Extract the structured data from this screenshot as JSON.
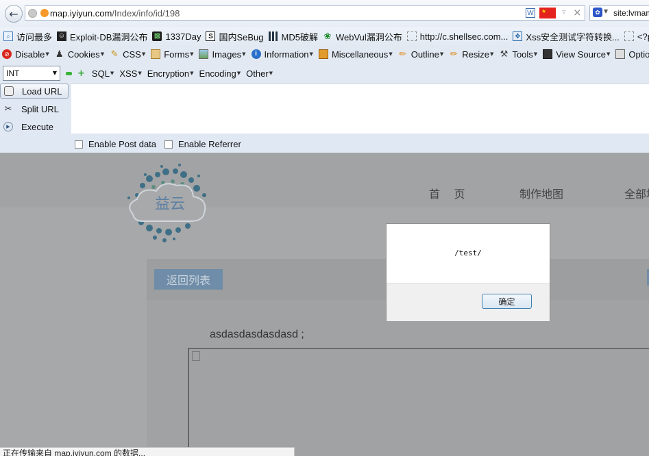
{
  "browser": {
    "url_host": "map.iyiyun.com",
    "url_path": "/Index/info/id/198",
    "search_text": "site:lvmama"
  },
  "bookmarks": [
    {
      "label": "访问最多",
      "icon": "most-visited-icon"
    },
    {
      "label": "Exploit-DB漏洞公布",
      "icon": "exploit-db-icon"
    },
    {
      "label": "1337Day",
      "icon": "1337day-icon"
    },
    {
      "label": "国内SeBug",
      "icon": "sebug-icon"
    },
    {
      "label": "MD5破解",
      "icon": "md5-icon"
    },
    {
      "label": "WebVul漏洞公布",
      "icon": "webvul-icon"
    },
    {
      "label": "http://c.shellsec.com...",
      "icon": "page-icon"
    },
    {
      "label": "Xss安全测试字符转换...",
      "icon": "xss-tool-icon"
    },
    {
      "label": "<?php",
      "icon": "page-icon"
    }
  ],
  "toolbar": {
    "items": [
      {
        "label": "Disable",
        "icon": "disable-icon",
        "color": "#d22"
      },
      {
        "label": "Cookies",
        "icon": "cookies-icon",
        "color": "#333"
      },
      {
        "label": "CSS",
        "icon": "css-icon",
        "color": "#c90"
      },
      {
        "label": "Forms",
        "icon": "forms-icon",
        "color": "#c80"
      },
      {
        "label": "Images",
        "icon": "images-icon",
        "color": "#4a7"
      },
      {
        "label": "Information",
        "icon": "information-icon",
        "color": "#27c"
      },
      {
        "label": "Miscellaneous",
        "icon": "miscellaneous-icon",
        "color": "#e90"
      },
      {
        "label": "Outline",
        "icon": "outline-icon",
        "color": "#e90"
      },
      {
        "label": "Resize",
        "icon": "resize-icon",
        "color": "#e90"
      },
      {
        "label": "Tools",
        "icon": "tools-icon",
        "color": "#555"
      },
      {
        "label": "View Source",
        "icon": "view-source-icon",
        "color": "#333"
      },
      {
        "label": "Options",
        "icon": "options-icon",
        "color": "#555"
      }
    ]
  },
  "hackbar": {
    "type_select": "INT",
    "menus": [
      "SQL",
      "XSS",
      "Encryption",
      "Encoding",
      "Other"
    ],
    "load_url": "Load URL",
    "split_url": "Split URL",
    "execute": "Execute",
    "url_value": "",
    "enable_post": "Enable Post data",
    "enable_referrer": "Enable Referrer"
  },
  "site": {
    "logo_text": "益云",
    "nav": [
      "首 页",
      "制作地图",
      "全部地图"
    ],
    "back_button": "返回列表",
    "body_text": "asdasdasdasdasd ;"
  },
  "dialog": {
    "message": "/test/",
    "ok": "确定"
  },
  "status_text": "正在传输来自 map.iyiyun.com 的数据..."
}
